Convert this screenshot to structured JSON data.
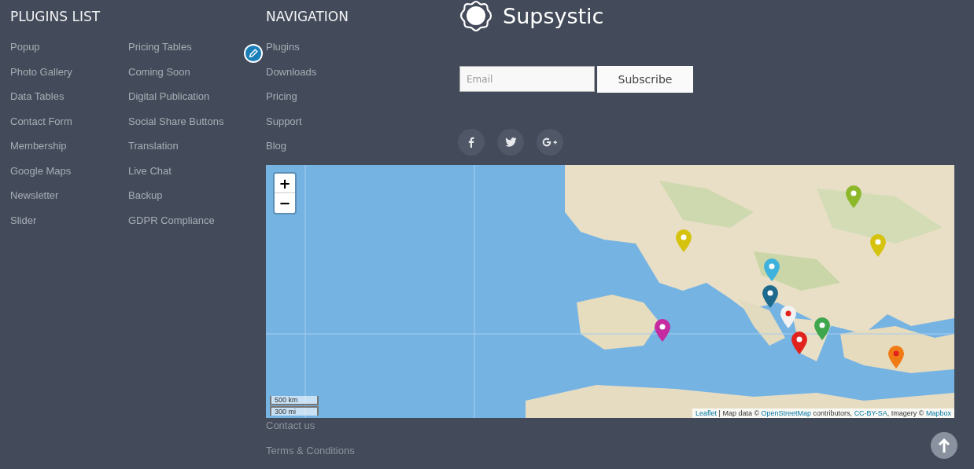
{
  "plugins_list": {
    "heading": "PLUGINS LIST",
    "columns": [
      [
        "Popup",
        "Photo Gallery",
        "Data Tables",
        "Contact Form",
        "Membership",
        "Google Maps",
        "Newsletter",
        "Slider"
      ],
      [
        "Pricing Tables",
        "Coming Soon",
        "Digital Publication",
        "Social Share Buttons",
        "Translation",
        "Live Chat",
        "Backup",
        "GDPR Compliance"
      ]
    ]
  },
  "navigation": {
    "heading": "NAVIGATION",
    "items": [
      "Plugins",
      "Downloads",
      "Pricing",
      "Support",
      "Blog"
    ],
    "items_below_map": [
      "Contact us",
      "Terms & Conditions"
    ]
  },
  "brand": {
    "name": "Supsystic"
  },
  "subscribe": {
    "placeholder": "Email",
    "button": "Subscribe"
  },
  "social": [
    {
      "kind": "facebook"
    },
    {
      "kind": "twitter"
    },
    {
      "kind": "googleplus"
    }
  ],
  "map": {
    "zoom_in": "+",
    "zoom_out": "−",
    "scale": [
      "500 km",
      "300 mi"
    ],
    "attribution": [
      {
        "text": "Leaflet",
        "link": true
      },
      {
        "text": " | Map data © ",
        "link": false
      },
      {
        "text": "OpenStreetMap",
        "link": true
      },
      {
        "text": " contributors, ",
        "link": false
      },
      {
        "text": "CC-BY-SA",
        "link": true
      },
      {
        "text": ", Imagery © ",
        "link": false
      },
      {
        "text": "Mapbox",
        "link": true
      }
    ],
    "markers": [
      {
        "color": "#8db82a"
      },
      {
        "color": "#d6c310"
      },
      {
        "color": "#d6c310"
      },
      {
        "color": "#3cb2dc"
      },
      {
        "color": "#1e6a8c"
      },
      {
        "color": "#f2f2f2"
      },
      {
        "color": "#3ea64c"
      },
      {
        "color": "#c62aa0"
      },
      {
        "color": "#e2221c"
      },
      {
        "color": "#f07a14"
      }
    ]
  }
}
